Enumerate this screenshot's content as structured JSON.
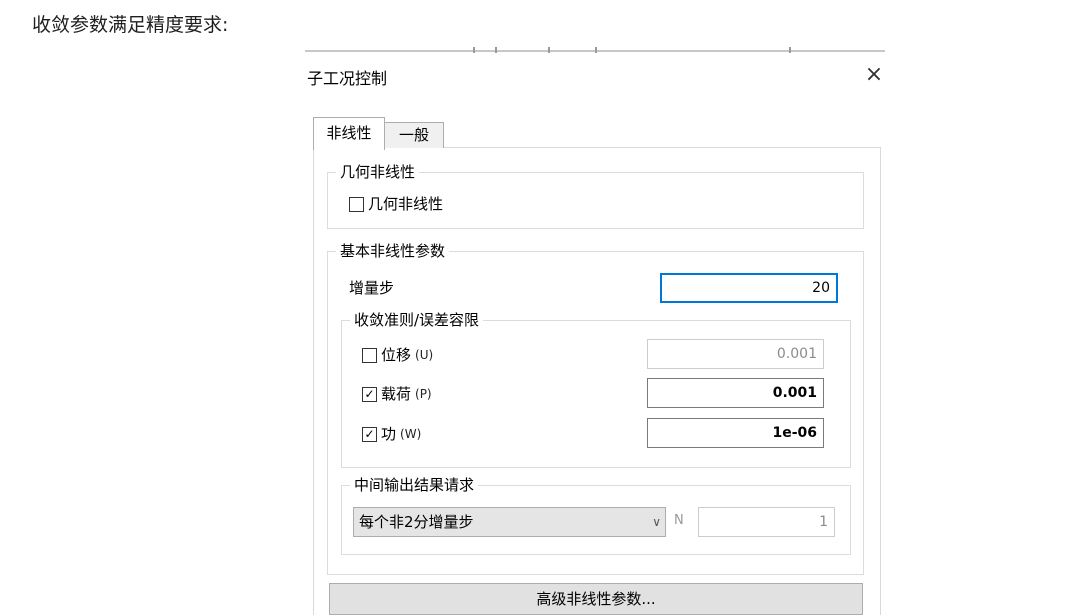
{
  "doc": {
    "intro": "收敛参数满足精度要求:"
  },
  "dialog": {
    "title": "子工况控制",
    "close_label": "×",
    "tabs": [
      {
        "label": "非线性",
        "active": true
      },
      {
        "label": "一般",
        "active": false
      }
    ],
    "geometric": {
      "group_label": "几何非线性",
      "checkbox_label": "几何非线性",
      "checked": false
    },
    "basic": {
      "group_label": "基本非线性参数",
      "increment_label": "增量步",
      "increment_value": "20",
      "convergence": {
        "group_label": "收敛准则/误差容限",
        "rows": [
          {
            "label": "位移",
            "sub": "(U)",
            "checked": false,
            "check_mark": "",
            "value": "0.001"
          },
          {
            "label": "载荷",
            "sub": "(P)",
            "checked": true,
            "check_mark": "✓",
            "value": "0.001"
          },
          {
            "label": "功",
            "sub": "(W)",
            "checked": true,
            "check_mark": "✓",
            "value": "1e-06"
          }
        ]
      },
      "output": {
        "group_label": "中间输出结果请求",
        "select_value": "每个非2分增量步",
        "n_label": "N",
        "n_value": "1"
      }
    },
    "advanced_button": "高级非线性参数..."
  },
  "colors": {
    "focus_border": "#0078d7",
    "disabled_text": "#8c8c8c",
    "button_bg": "#e1e1e1"
  }
}
